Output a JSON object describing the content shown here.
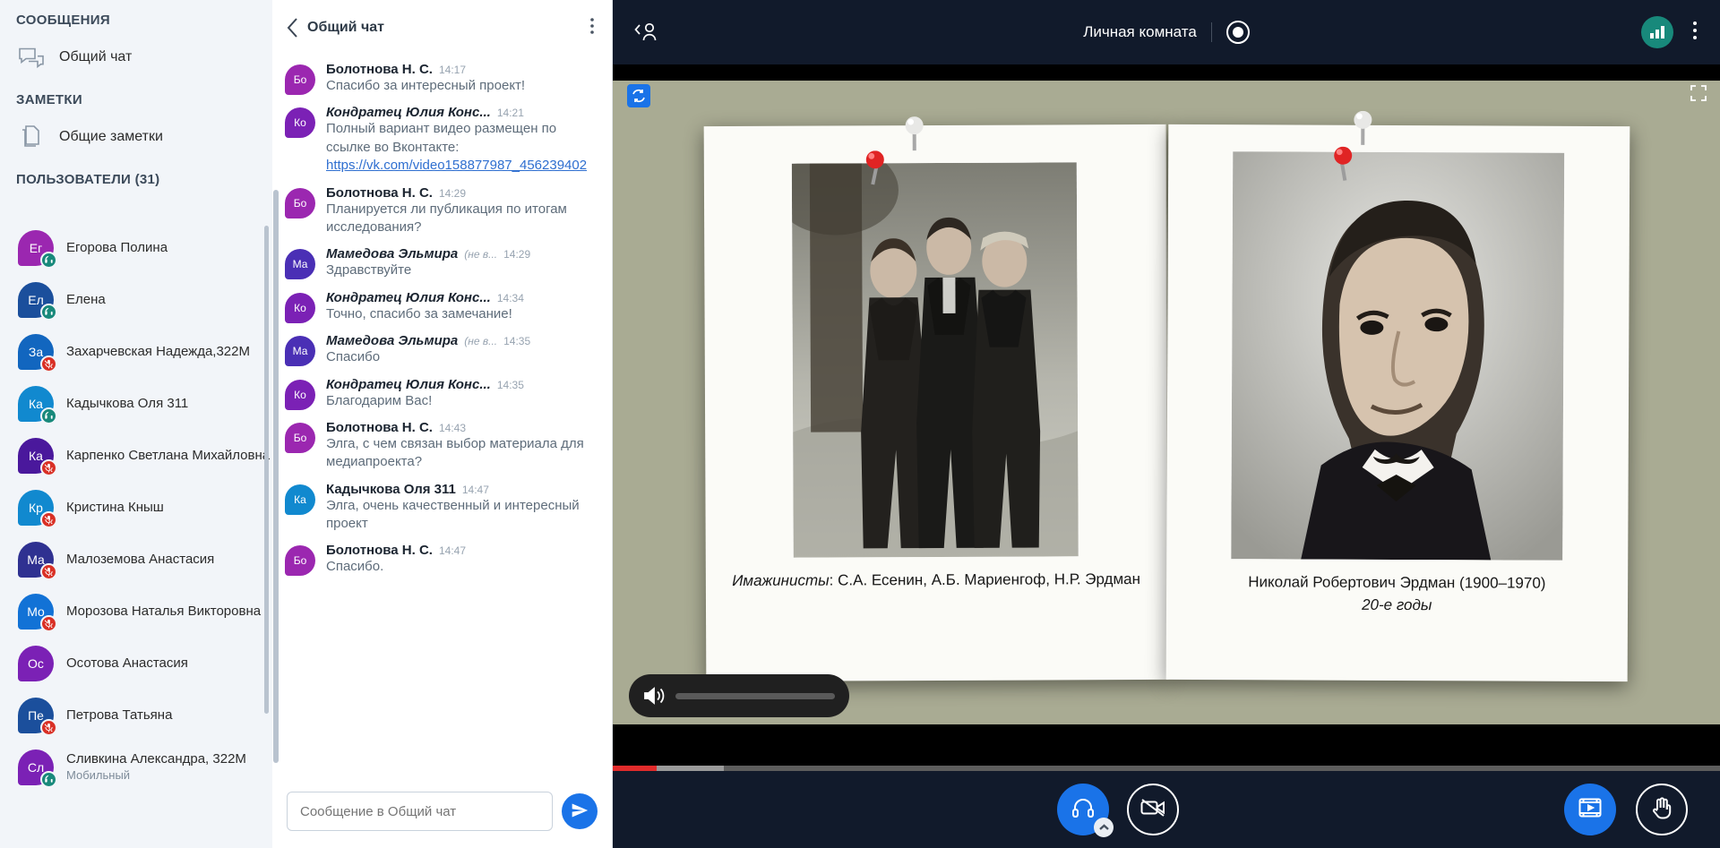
{
  "sidebar": {
    "messages_title": "СООБЩЕНИЯ",
    "public_chat_label": "Общий чат",
    "notes_title": "ЗАМЕТКИ",
    "shared_notes_label": "Общие заметки",
    "users_title": "ПОЛЬЗОВАТЕЛИ",
    "users_count": "(31)",
    "users": [
      {
        "initials": "Ег",
        "name": "Егорова Полина",
        "sub": "",
        "color": "#9b27b0",
        "badge": "headset"
      },
      {
        "initials": "Ел",
        "name": "Елена",
        "sub": "",
        "color": "#1b4f9c",
        "badge": "headset"
      },
      {
        "initials": "За",
        "name": "Захарчевская Надежда,322М",
        "sub": "",
        "color": "#1266bf",
        "badge": "muted"
      },
      {
        "initials": "Ка",
        "name": "Кадычкова Оля 311",
        "sub": "",
        "color": "#1189cf",
        "badge": "headset"
      },
      {
        "initials": "Ка",
        "name": "Карпенко Светлана Михайловна",
        "sub": "",
        "color": "#4a189c",
        "badge": "muted"
      },
      {
        "initials": "Кр",
        "name": "Кристина Кныш",
        "sub": "",
        "color": "#1189cf",
        "badge": "muted"
      },
      {
        "initials": "Ма",
        "name": "Малоземова Анастасия",
        "sub": "",
        "color": "#2f3191",
        "badge": "muted"
      },
      {
        "initials": "Мо",
        "name": "Морозова Наталья Викторовна",
        "sub": "",
        "color": "#1272d6",
        "badge": "muted"
      },
      {
        "initials": "Ос",
        "name": "Осотова Анастасия",
        "sub": "",
        "color": "#7b21b5",
        "badge": ""
      },
      {
        "initials": "Пе",
        "name": "Петрова Татьяна",
        "sub": "",
        "color": "#1b4f9c",
        "badge": "muted"
      },
      {
        "initials": "Сл",
        "name": "Сливкина Александра, 322М",
        "sub": "Мобильный",
        "color": "#7b21b5",
        "badge": "headset"
      }
    ]
  },
  "chat": {
    "title": "Общий чат",
    "back_icon": "chevron-left-icon",
    "menu_icon": "kebab-menu-icon",
    "input_placeholder": "Сообщение в Общий чат",
    "input_value": "",
    "send_icon": "send-icon",
    "messages": [
      {
        "initials": "Бо",
        "color": "#9b27b0",
        "name": "Болотнова Н. С.",
        "tag": "",
        "time": "14:17",
        "text": "Спасибо за интересный проект!",
        "italic": false,
        "link": ""
      },
      {
        "initials": "Ко",
        "color": "#7b21b5",
        "name": "Кондратец Юлия Конс...",
        "tag": "",
        "time": "14:21",
        "text": "Полный вариант видео размещен по ссылке во Вконтакте:",
        "italic": true,
        "link": "https://vk.com/video158877987_456239402"
      },
      {
        "initials": "Бо",
        "color": "#9b27b0",
        "name": "Болотнова Н. С.",
        "tag": "",
        "time": "14:29",
        "text": "Планируется ли публикация по итогам исследования?",
        "italic": false,
        "link": ""
      },
      {
        "initials": "Ма",
        "color": "#4a2fb5",
        "name": "Мамедова Эльмира",
        "tag": "(не в...",
        "time": "14:29",
        "text": "Здравствуйте",
        "italic": true,
        "link": ""
      },
      {
        "initials": "Ко",
        "color": "#7b21b5",
        "name": "Кондратец Юлия Конс...",
        "tag": "",
        "time": "14:34",
        "text": "Точно, спасибо за замечание!",
        "italic": true,
        "link": ""
      },
      {
        "initials": "Ма",
        "color": "#4a2fb5",
        "name": "Мамедова Эльмира",
        "tag": "(не в...",
        "time": "14:35",
        "text": "Спасибо",
        "italic": true,
        "link": ""
      },
      {
        "initials": "Ко",
        "color": "#7b21b5",
        "name": "Кондратец Юлия Конс...",
        "tag": "",
        "time": "14:35",
        "text": "Благодарим Вас!",
        "italic": true,
        "link": ""
      },
      {
        "initials": "Бо",
        "color": "#9b27b0",
        "name": "Болотнова Н. С.",
        "tag": "",
        "time": "14:43",
        "text": "Элга, с чем связан выбор материала для медиапроекта?",
        "italic": false,
        "link": ""
      },
      {
        "initials": "Ка",
        "color": "#1189cf",
        "name": "Кадычкова Оля 311",
        "tag": "",
        "time": "14:47",
        "text": "Элга, очень качественный и интересный проект",
        "italic": false,
        "link": ""
      },
      {
        "initials": "Бо",
        "color": "#9b27b0",
        "name": "Болотнова Н. С.",
        "tag": "",
        "time": "14:47",
        "text": "Спасибо.",
        "italic": false,
        "link": ""
      }
    ]
  },
  "topbar": {
    "back_user_icon": "back-to-user-icon",
    "room_name": "Личная комната",
    "recording_icon": "record-indicator-icon",
    "signal_icon": "connection-status-icon",
    "menu_icon": "options-menu-icon"
  },
  "stage": {
    "refresh_icon": "refresh-presentation-icon",
    "fullscreen_icon": "fullscreen-icon",
    "volume_icon": "speaker-icon",
    "volume_percent": 85,
    "progress_played_percent": 4,
    "progress_buffered_percent": 10,
    "slide_left_caption_italic": "Имажинисты",
    "slide_left_caption_rest": ": С.А. Есенин, А.Б. Мариенгоф, Н.Р. Эрдман",
    "slide_right_caption": "Николай Робертович Эрдман (1900–1970)",
    "slide_right_caption_italic": "20-е годы"
  },
  "bottombar": {
    "audio_label": "headset-icon",
    "audio_caret": "chevron-up-icon",
    "video_label": "camera-off-icon",
    "presentation_label": "presentation-icon",
    "raisehand_label": "raise-hand-icon"
  },
  "colors": {
    "accent": "#1a73e8",
    "dark": "#111a2b",
    "sidebar_bg": "#f2f5f9",
    "muted_badge": "#d93025",
    "headset_badge": "#18897b"
  }
}
